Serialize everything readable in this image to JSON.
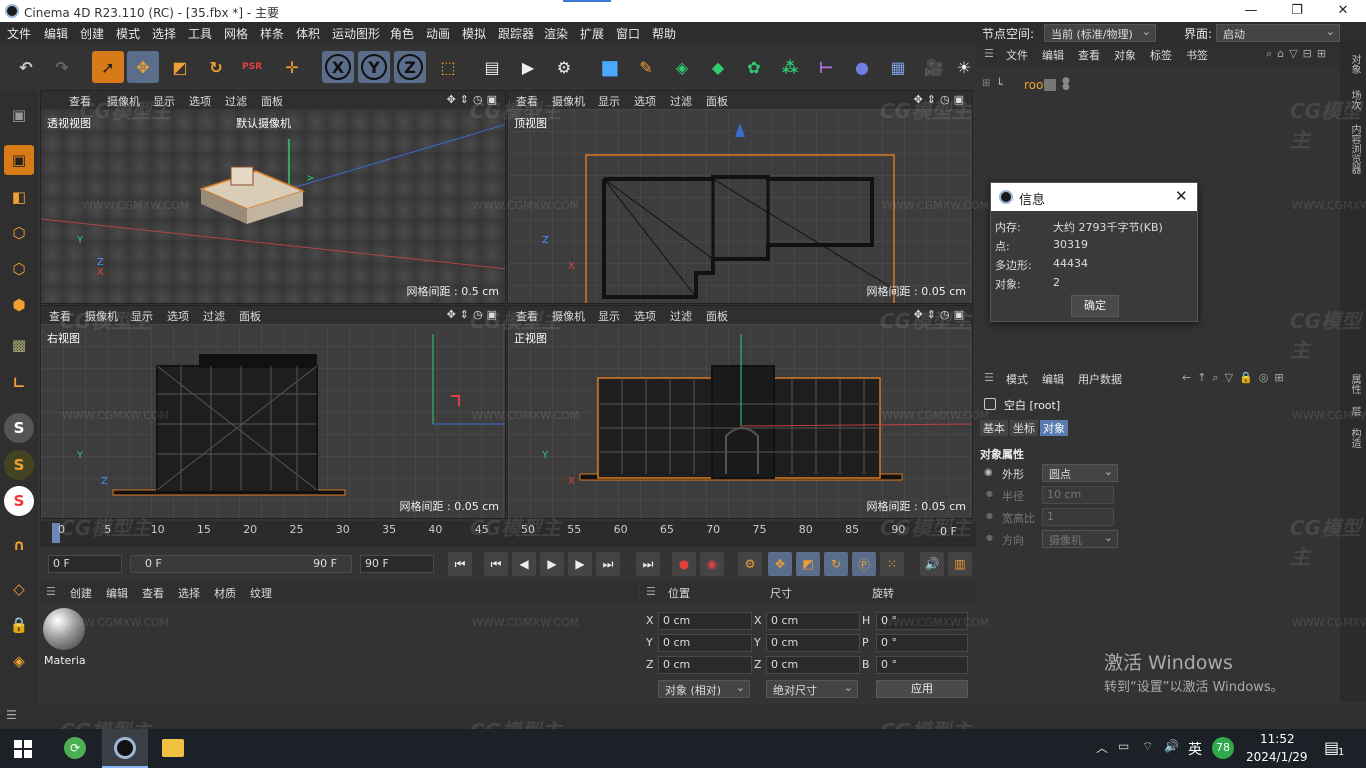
{
  "window": {
    "title": "Cinema 4D R23.110 (RC) - [35.fbx *] - 主要"
  },
  "menu": [
    "文件",
    "编辑",
    "创建",
    "模式",
    "选择",
    "工具",
    "网格",
    "样条",
    "体积",
    "运动图形",
    "角色",
    "动画",
    "模拟",
    "跟踪器",
    "渲染",
    "扩展",
    "窗口",
    "帮助"
  ],
  "nodespace": {
    "label": "节点空间:",
    "value": "当前 (标准/物理)"
  },
  "layout": {
    "label": "界面:",
    "value": "启动"
  },
  "toolbar": {
    "x": "X",
    "y": "Y",
    "z": "Z",
    "psr": "PSR"
  },
  "viewports": [
    {
      "menu": [
        "查看",
        "摄像机",
        "显示",
        "选项",
        "过滤",
        "面板"
      ],
      "name": "透视视图",
      "camera": "默认摄像机",
      "grid": "网格间距 : 0.5 cm"
    },
    {
      "menu": [
        "查看",
        "摄像机",
        "显示",
        "选项",
        "过滤",
        "面板"
      ],
      "name": "顶视图",
      "grid": "网格间距 : 0.05 cm"
    },
    {
      "menu": [
        "查看",
        "摄像机",
        "显示",
        "选项",
        "过滤",
        "面板"
      ],
      "name": "右视图",
      "grid": "网格间距 : 0.05 cm"
    },
    {
      "menu": [
        "查看",
        "摄像机",
        "显示",
        "选项",
        "过滤",
        "面板"
      ],
      "name": "正视图",
      "grid": "网格间距 : 0.05 cm"
    }
  ],
  "axes": {
    "x": "X",
    "y": "Y",
    "z": "Z"
  },
  "timeline": {
    "ticks": [
      "0",
      "5",
      "10",
      "15",
      "20",
      "25",
      "30",
      "35",
      "40",
      "45",
      "50",
      "55",
      "60",
      "65",
      "70",
      "75",
      "80",
      "85",
      "90"
    ],
    "end_label": "0 F",
    "current": "0 F",
    "range_start": "0 F",
    "range_end": "90 F",
    "max": "90 F"
  },
  "material": {
    "menu": [
      "创建",
      "编辑",
      "查看",
      "选择",
      "材质",
      "纹理"
    ],
    "item": "Materia"
  },
  "coords": {
    "headers": [
      "位置",
      "尺寸",
      "旋转"
    ],
    "rows": [
      {
        "a": "X",
        "pos": "0 cm",
        "b": "X",
        "size": "0 cm",
        "c": "H",
        "rot": "0 °"
      },
      {
        "a": "Y",
        "pos": "0 cm",
        "b": "Y",
        "size": "0 cm",
        "c": "P",
        "rot": "0 °"
      },
      {
        "a": "Z",
        "pos": "0 cm",
        "b": "Z",
        "size": "0 cm",
        "c": "B",
        "rot": "0 °"
      }
    ],
    "mode": "对象 (相对)",
    "size_mode": "绝对尺寸",
    "apply": "应用"
  },
  "objects": {
    "menu": [
      "文件",
      "编辑",
      "查看",
      "对象",
      "标签",
      "书签"
    ],
    "root": "root"
  },
  "attributes": {
    "menu": [
      "模式",
      "编辑",
      "用户数据"
    ],
    "object": "空白 [root]",
    "tabs": [
      "基本",
      "坐标",
      "对象"
    ],
    "section": "对象属性",
    "rows": [
      {
        "label": "外形",
        "value": "圆点"
      },
      {
        "label": "半径",
        "value": "10 cm"
      },
      {
        "label": "宽高比",
        "value": "1"
      },
      {
        "label": "方向",
        "value": "摄像机"
      }
    ]
  },
  "rightstrip": [
    "对象",
    "场次",
    "内容浏览器",
    "属性",
    "层",
    "构造"
  ],
  "info": {
    "title": "信息",
    "rows": [
      {
        "k": "内存:",
        "v": "大约 2793千字节(KB)"
      },
      {
        "k": "点:",
        "v": "30319"
      },
      {
        "k": "多边形:",
        "v": "44434"
      },
      {
        "k": "对象:",
        "v": "2"
      }
    ],
    "ok": "确定"
  },
  "activate": {
    "title": "激活 Windows",
    "sub": "转到“设置”以激活 Windows。"
  },
  "watermark": {
    "logo": "CG模型主",
    "url": "WWW.CGMXW.COM"
  },
  "taskbar": {
    "time": "11:52",
    "date": "2024/1/29",
    "ime": "英",
    "badge": "78",
    "notif": "1"
  },
  "colors": {
    "accent": "#5a7ab0",
    "orange": "#e07b1a",
    "green": "#2ecc71",
    "blue": "#4a8cff",
    "red": "#e04040"
  }
}
